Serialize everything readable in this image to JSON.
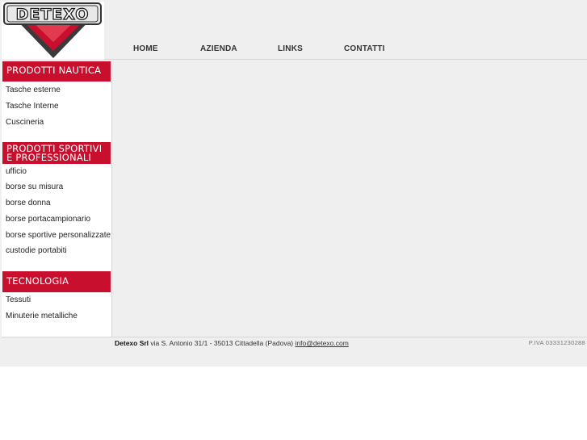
{
  "brand": {
    "name": "DETEXO",
    "accent": "#c8102e"
  },
  "nav": [
    "HOME",
    "AZIENDA",
    "LINKS",
    "CONTATTI"
  ],
  "sidebar": {
    "sections": [
      {
        "title_lines": [
          "PRODOTTI NAUTICA"
        ],
        "items": [
          "Tasche esterne",
          "Tasche Interne",
          "Cuscineria"
        ]
      },
      {
        "title_lines": [
          "PRODOTTI SPORTIVI",
          "E PROFESSIONALI"
        ],
        "items": [
          "ufficio",
          "borse su misura",
          "borse donna",
          "borse portacampionario",
          "borse sportive personalizzate",
          "custodie portabiti"
        ]
      },
      {
        "title_lines": [
          "TECNOLOGIA"
        ],
        "items": [
          "Tessuti",
          "Minuterie metalliche"
        ]
      }
    ]
  },
  "footer": {
    "company": "Detexo Srl",
    "address": " via S. Antonio 31/1 - 35013 Cittadella (Padova) ",
    "email": "info@detexo.com",
    "vat": "P.IVA 03331230288"
  }
}
